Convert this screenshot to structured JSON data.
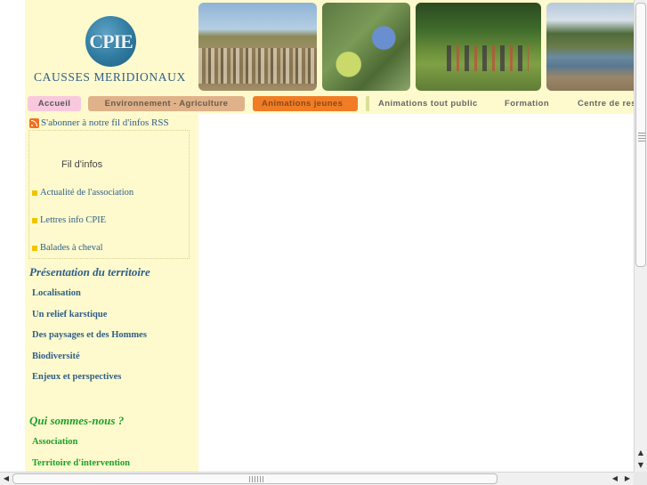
{
  "site": {
    "logo_text": "CPIE",
    "name": "CAUSSES MERIDIONAUX"
  },
  "nav": {
    "items": [
      {
        "label": "Accueil"
      },
      {
        "label": "Environnement - Agriculture"
      },
      {
        "label": "Animations jeunes"
      },
      {
        "label": "Animations tout public"
      },
      {
        "label": "Formation"
      },
      {
        "label": "Centre de ress"
      }
    ]
  },
  "sidebar": {
    "rss_link": "S'abonner à notre fil d'infos RSS",
    "feed": {
      "title": "Fil d'infos",
      "items": [
        {
          "label": "Actualité de l'association"
        },
        {
          "label": "Lettres info CPIE"
        },
        {
          "label": "Balades à cheval"
        }
      ]
    },
    "sections": [
      {
        "title": "Présentation du territoire",
        "links": [
          {
            "label": "Localisation"
          },
          {
            "label": "Un relief karstique"
          },
          {
            "label": "Des paysages et des Hommes"
          },
          {
            "label": "Biodiversité"
          },
          {
            "label": "Enjeux et perspectives"
          }
        ]
      },
      {
        "title": "Qui sommes-nous ?",
        "links": [
          {
            "label": "Association"
          },
          {
            "label": "Territoire d'intervention"
          }
        ]
      }
    ]
  },
  "scrollbars": {
    "up_arrow": "▲",
    "down_arrow": "▼",
    "left_arrow": "◀",
    "right_arrow": "▶"
  },
  "colors": {
    "sidebar_bg": "#fffacd",
    "link_blue": "#2d5f88",
    "link_green": "#1aa028",
    "nav_accueil": "#f9c8de",
    "nav_environnement": "#dfb28a",
    "nav_animations_jeunes": "#f07d26"
  }
}
